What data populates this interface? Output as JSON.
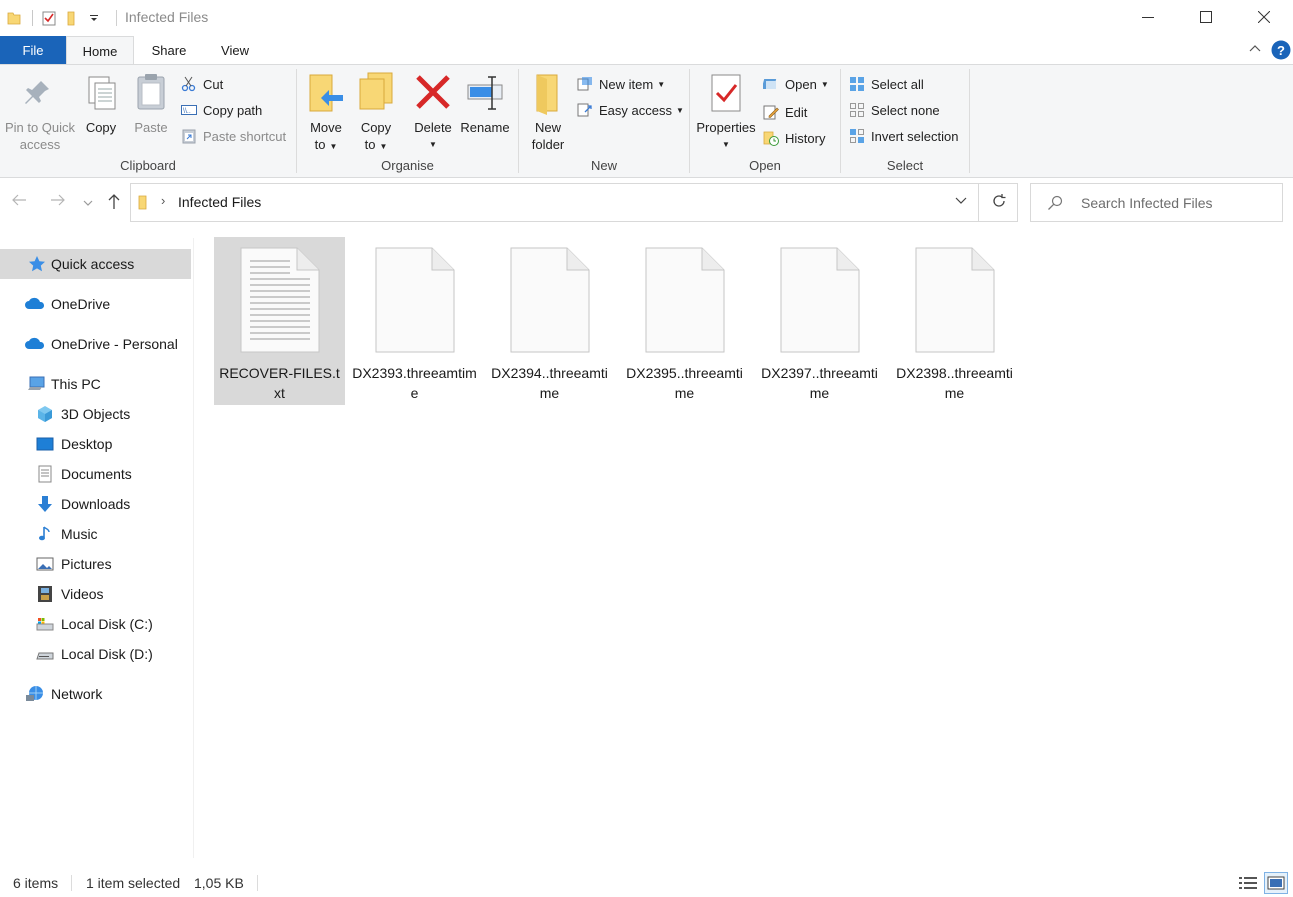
{
  "window": {
    "title": "Infected Files"
  },
  "ribbon_tabs": {
    "file": "File",
    "home": "Home",
    "share": "Share",
    "view": "View"
  },
  "ribbon": {
    "clipboard": {
      "label": "Clipboard",
      "pin_line1": "Pin to Quick",
      "pin_line2": "access",
      "copy": "Copy",
      "paste": "Paste",
      "cut": "Cut",
      "copy_path": "Copy path",
      "paste_shortcut": "Paste shortcut"
    },
    "organise": {
      "label": "Organise",
      "move_to_line1": "Move",
      "move_to_line2": "to",
      "copy_to_line1": "Copy",
      "copy_to_line2": "to",
      "delete": "Delete",
      "rename": "Rename"
    },
    "new": {
      "label": "New",
      "new_folder_line1": "New",
      "new_folder_line2": "folder",
      "new_item": "New item",
      "easy_access": "Easy access"
    },
    "open": {
      "label": "Open",
      "properties": "Properties",
      "open": "Open",
      "edit": "Edit",
      "history": "History"
    },
    "select": {
      "label": "Select",
      "select_all": "Select all",
      "select_none": "Select none",
      "invert_selection": "Invert selection"
    }
  },
  "address": {
    "path": "Infected Files",
    "search_placeholder": "Search Infected Files"
  },
  "nav": {
    "quick_access": "Quick access",
    "onedrive": "OneDrive",
    "onedrive_personal": "OneDrive - Personal",
    "this_pc": "This PC",
    "objects_3d": "3D Objects",
    "desktop": "Desktop",
    "documents": "Documents",
    "downloads": "Downloads",
    "music": "Music",
    "pictures": "Pictures",
    "videos": "Videos",
    "local_c": "Local Disk (C:)",
    "local_d": "Local Disk (D:)",
    "network": "Network"
  },
  "files": [
    {
      "name": "RECOVER-FILES.txt",
      "selected": true
    },
    {
      "name": "DX2393.threeamtime",
      "selected": false
    },
    {
      "name": "DX2394..threeamtime",
      "selected": false
    },
    {
      "name": "DX2395..threeamtime",
      "selected": false
    },
    {
      "name": "DX2397..threeamtime",
      "selected": false
    },
    {
      "name": "DX2398..threeamtime",
      "selected": false
    }
  ],
  "status": {
    "count": "6 items",
    "selected": "1 item selected",
    "size": "1,05 KB"
  },
  "colors": {
    "accent": "#1a64b9",
    "folder": "#f8d775",
    "delete_red": "#d72828",
    "selection": "#d9d9d9"
  }
}
